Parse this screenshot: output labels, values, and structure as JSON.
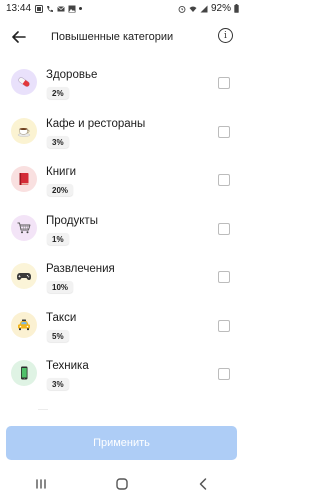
{
  "status_bar": {
    "time": "13:44",
    "battery": "92%",
    "left_icons": [
      "gallery-icon",
      "phone-icon",
      "mail-icon",
      "image-icon"
    ],
    "right_icons": [
      "alarm-icon",
      "wifi-icon",
      "signal-icon",
      "battery-icon"
    ]
  },
  "header": {
    "title": "Повышенные категории",
    "back_icon": "arrow-left-icon",
    "info_icon": "info-icon",
    "info_glyph": "i"
  },
  "categories": [
    {
      "label": "Здоровье",
      "percent": "2%",
      "icon": "pill-icon",
      "bg": "#e9e1fb"
    },
    {
      "label": "Кафе и рестораны",
      "percent": "3%",
      "icon": "coffee-icon",
      "bg": "#fbf3d2"
    },
    {
      "label": "Книги",
      "percent": "20%",
      "icon": "book-icon",
      "bg": "#f9e0e0"
    },
    {
      "label": "Продукты",
      "percent": "1%",
      "icon": "cart-icon",
      "bg": "#f3e4f7"
    },
    {
      "label": "Развлечения",
      "percent": "10%",
      "icon": "gamepad-icon",
      "bg": "#fbf4d8"
    },
    {
      "label": "Такси",
      "percent": "5%",
      "icon": "taxi-icon",
      "bg": "#fbf1d2"
    },
    {
      "label": "Техника",
      "percent": "3%",
      "icon": "smartphone-icon",
      "bg": "#dff3e4"
    }
  ],
  "apply_button": {
    "label": "Применить",
    "color": "#aecdf6"
  },
  "nav_bar": {
    "icons": [
      "recent-apps-icon",
      "home-icon",
      "back-nav-icon"
    ]
  }
}
